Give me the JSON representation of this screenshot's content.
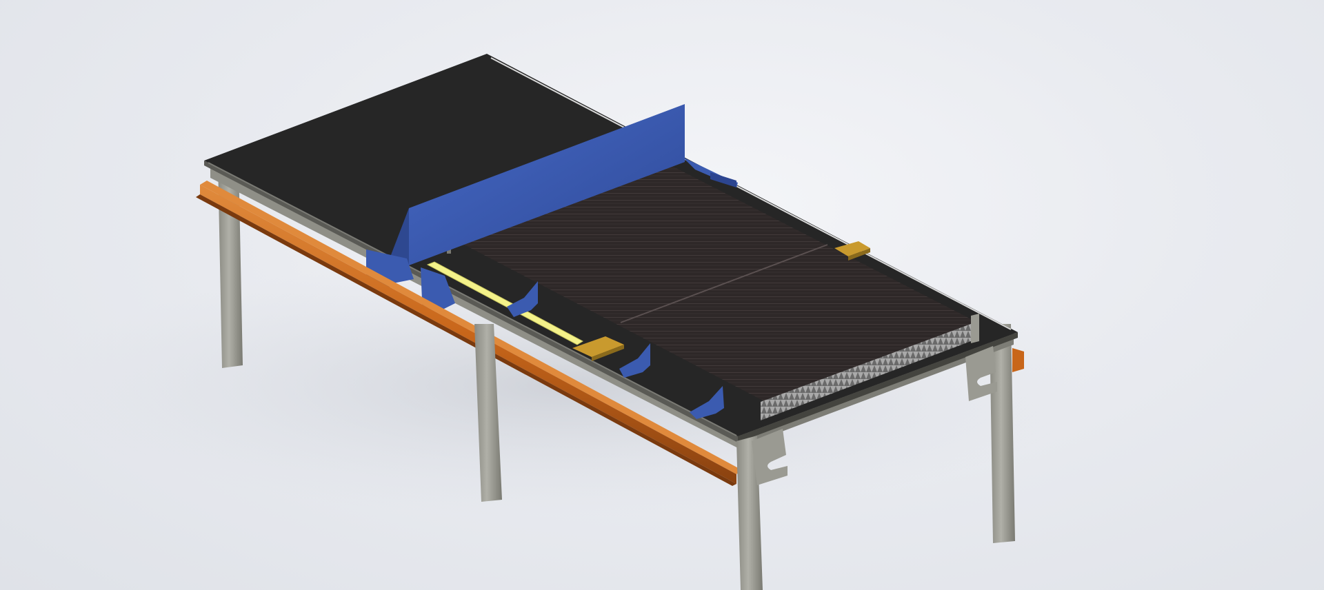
{
  "scene": {
    "subject": "cnc-cutting-table-render",
    "colors": {
      "background": "#eceef2",
      "table_top": "#262626",
      "frame_steel": "#8d8d85",
      "leg_steel": "#9a9a92",
      "rail_orange": "#c8661a",
      "gantry_blue": "#3b5bb0",
      "slat_grid": "#3a3434",
      "clamp_gold": "#c99a2e",
      "guide_yellow": "#f4f28a"
    }
  }
}
